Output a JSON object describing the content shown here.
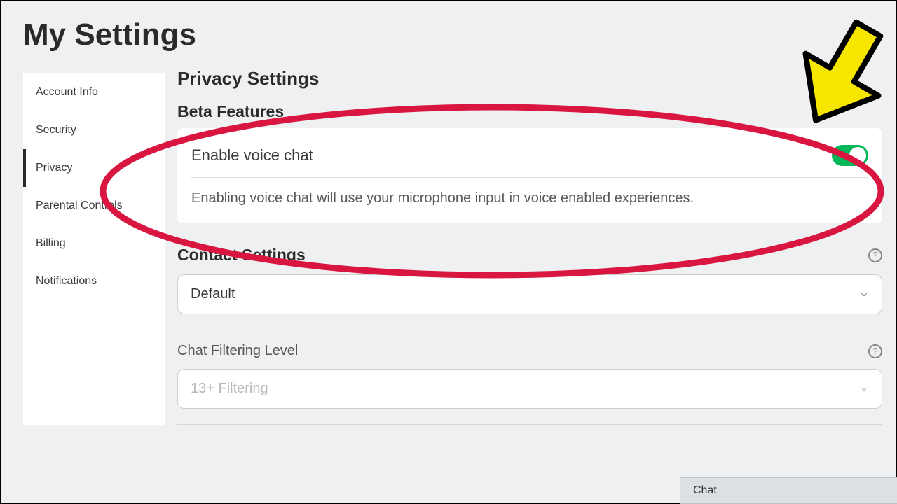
{
  "page_title": "My Settings",
  "sidebar": {
    "items": [
      {
        "label": "Account Info"
      },
      {
        "label": "Security"
      },
      {
        "label": "Privacy"
      },
      {
        "label": "Parental Controls"
      },
      {
        "label": "Billing"
      },
      {
        "label": "Notifications"
      }
    ],
    "active_index": 2
  },
  "privacy": {
    "heading": "Privacy Settings",
    "beta_heading": "Beta Features",
    "voice_toggle_label": "Enable voice chat",
    "voice_toggle_on": true,
    "voice_desc": "Enabling voice chat will use your microphone input in voice enabled experiences.",
    "contact_heading": "Contact Settings",
    "contact_select_value": "Default",
    "filter_label": "Chat Filtering Level",
    "filter_select_value": "13+ Filtering"
  },
  "chat_bar_label": "Chat",
  "colors": {
    "accent_green": "#02b757",
    "annotation_red": "#d91640",
    "annotation_yellow": "#f7e600"
  }
}
